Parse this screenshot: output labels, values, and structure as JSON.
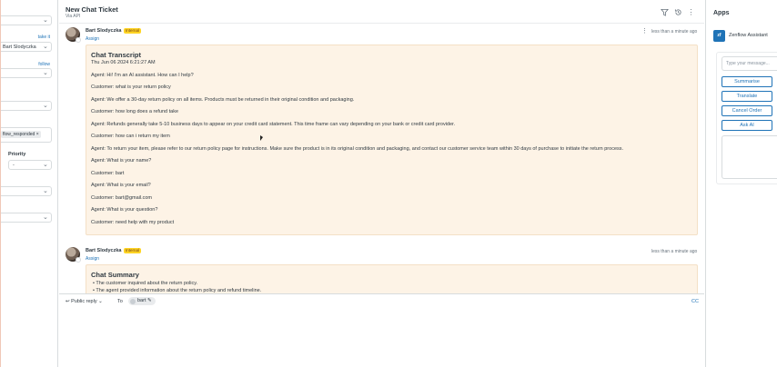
{
  "left_panel": {
    "take_it": "take it",
    "assignee": "Bart Slodyczka",
    "follow": "follow",
    "tag": "flow_responded",
    "tag_remove": "×",
    "priority_label": "Priority",
    "priority_value": "-"
  },
  "header": {
    "title": "New Chat Ticket",
    "subtitle": "Via API"
  },
  "messages": [
    {
      "author": "Bart Slodyczka",
      "badge": "Internal",
      "assign": "Assign",
      "time": "less than a minute ago",
      "note_title": "Chat Transcript",
      "note_date": "Thu Jun 06 2024 6:21:27 AM",
      "lines": [
        "Agent: Hi! I'm an AI assistant. How can I help?",
        "Customer: what is your return policy",
        "Agent: We offer a 30-day return policy on all items. Products must be returned in their original condition and packaging.",
        "Customer: how long does a refund take",
        "Agent: Refunds generally take 5-10 business days to appear on your credit card statement. This time frame can vary depending on your bank or credit card provider.",
        "Customer: how can i return my item",
        "Agent: To return your item, please refer to our return policy page for instructions. Make sure the product is in its original condition and packaging, and contact our customer service team within 30 days of purchase to initiate the return process.",
        "Agent: What is your name?",
        "Customer: bart",
        "Agent: What is your email?",
        "Customer: bart@gmail.com",
        "Agent: What is your question?",
        "Customer: need help with my product"
      ]
    },
    {
      "author": "Bart Slodyczka",
      "badge": "Internal",
      "assign": "Assign",
      "time": "less than a minute ago",
      "note_title": "Chat Summary",
      "lines": [
        "• The customer inquired about the return policy.",
        "• The agent provided information about the return policy and refund timeline."
      ]
    }
  ],
  "composer": {
    "reply_mode": "Public reply",
    "to_label": "To",
    "recipient": "bart",
    "cc": "CC"
  },
  "apps": {
    "title": "Apps",
    "app_logo": "zf",
    "app_name": "Zenflow Assistant",
    "input_placeholder": "Type your message...",
    "buttons": [
      "Summarise",
      "Translate",
      "Cancel Order",
      "Ask AI"
    ]
  },
  "colors": {
    "link": "#1f73b7",
    "internal_badge": "#ffd424",
    "note_background": "#fdf3e6"
  },
  "icons": [
    "filter-icon",
    "history-icon",
    "more-icon",
    "chevron-down-icon",
    "reply-arrow-icon",
    "pencil-icon"
  ]
}
